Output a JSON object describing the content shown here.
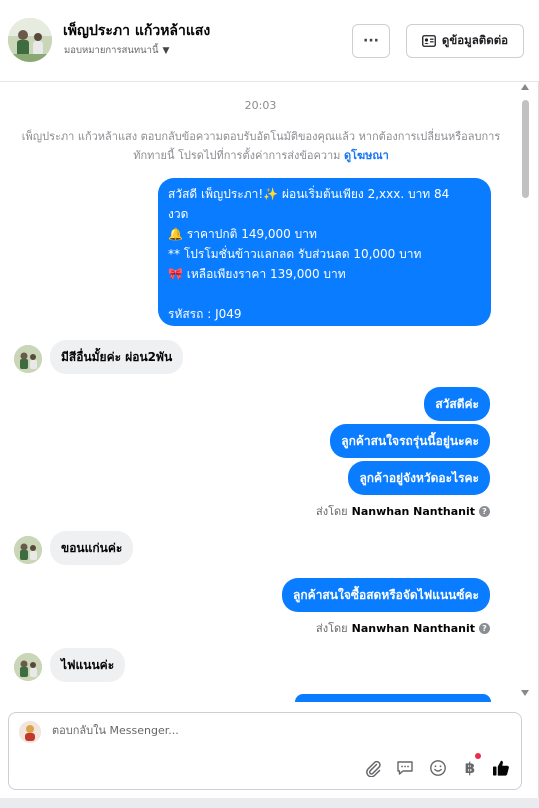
{
  "header": {
    "contact_name": "เพ็ญประภา แก้วหล้าแสง",
    "assign_label": "มอบหมายการสนทนานี้",
    "more_label": "···",
    "view_contact_label": "ดูข้อมูลติดต่อ"
  },
  "conversation": {
    "timestamp": "20:03",
    "notice_text": "เพ็ญประภา แก้วหล้าแสง ตอบกลับข้อความตอบรับอัตโนมัติของคุณแล้ว หากต้องการเปลี่ยนหรือลบการทักทายนี้ โปรดไปที่การตั้งค่าการส่งข้อความ",
    "notice_link": "ดูโฆษณา",
    "auto_reply": {
      "line1": "สวัสดี เพ็ญประภา!✨  ผ่อนเริ่มต้นเพียง 2,xxx. บาท 84",
      "line2": "งวด",
      "line3": "🔔 ราคาปกติ 149,000 บาท",
      "line4": "** โปรโมชั่นข้าวแลกลด รับส่วนลด 10,000 บาท",
      "line5": "🎀  เหลือเพียงราคา 139,000 บาท",
      "line6": "",
      "line7": "รหัสรถ : J049"
    },
    "msg_in_1": "มีสีอื่นมั้ยค่ะ ผ่อน2พัน",
    "msg_out_1": "สวัสดีค่ะ",
    "msg_out_2": "ลูกค้าสนใจรถรุ่นนี้อยู่นะคะ",
    "msg_out_3": "ลูกค้าอยู่จังหวัดอะไรคะ",
    "sent_by_label_1": "ส่งโดย",
    "sent_by_name_1": "Nanwhan Nanthanit",
    "msg_in_2": "ขอนแก่นค่ะ",
    "msg_out_4": "ลูกค้าสนใจซื้อสดหรือจัดไฟแนนซ์คะ",
    "sent_by_label_2": "ส่งโดย",
    "sent_by_name_2": "Nanwhan Nanthanit",
    "msg_in_3": "ไฟแนนค่ะ"
  },
  "composer": {
    "placeholder": "ตอบกลับใน Messenger...",
    "icons": [
      "attach-icon",
      "saved-reply-icon",
      "emoji-icon",
      "currency-icon",
      "like-icon"
    ]
  },
  "colors": {
    "outgoing_bubble": "#0a7cff",
    "incoming_bubble": "#eff0f2",
    "link": "#1877f2"
  }
}
